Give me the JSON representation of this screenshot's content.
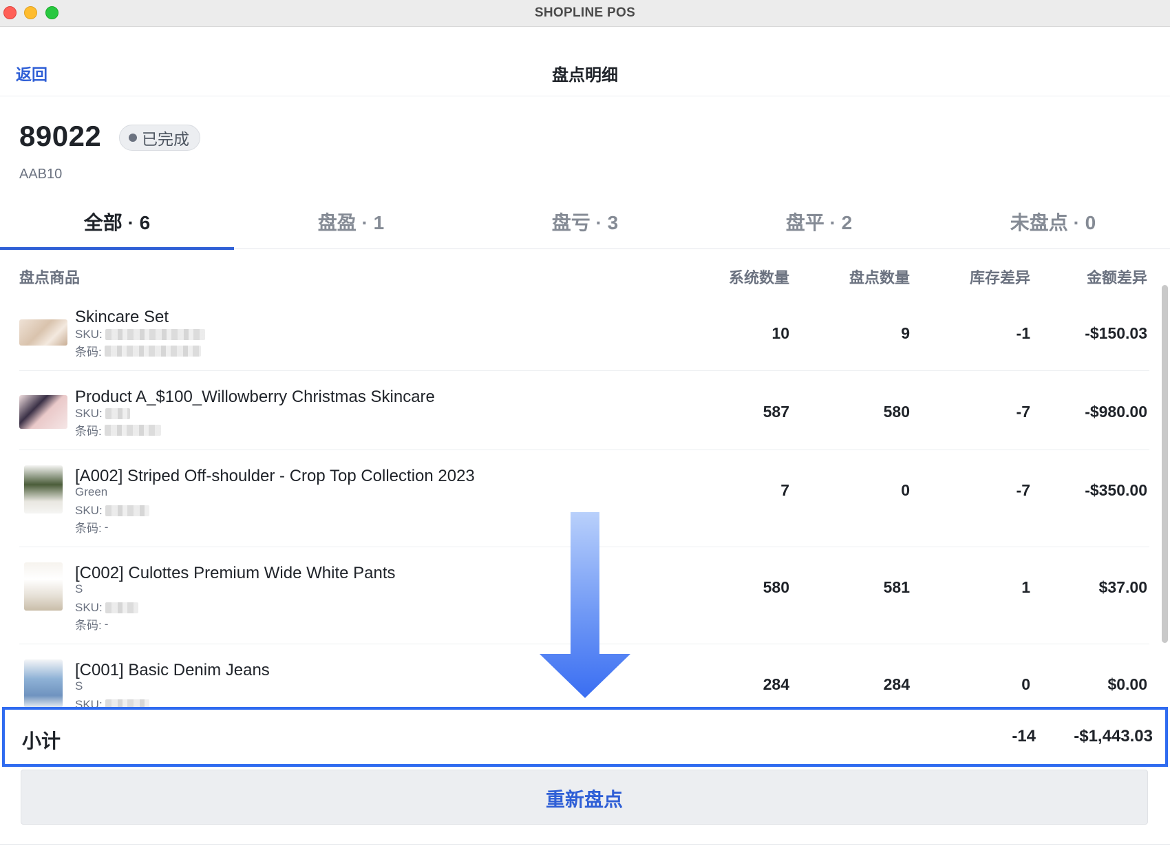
{
  "window": {
    "title": "SHOPLINE POS"
  },
  "nav": {
    "back_label": "返回",
    "title": "盘点明细"
  },
  "header": {
    "order_no": "89022",
    "status": "已完成",
    "store_code": "AAB10"
  },
  "tabs": [
    {
      "label": "全部 · 6",
      "active": true
    },
    {
      "label": "盘盈 · 1",
      "active": false
    },
    {
      "label": "盘亏 · 3",
      "active": false
    },
    {
      "label": "盘平 · 2",
      "active": false
    },
    {
      "label": "未盘点 · 0",
      "active": false
    }
  ],
  "table": {
    "columns": {
      "product": "盘点商品",
      "system_qty": "系统数量",
      "count_qty": "盘点数量",
      "stock_diff": "库存差异",
      "amount_diff": "金额差异"
    },
    "sku_label": "SKU:",
    "barcode_label": "条码:",
    "rows": [
      {
        "name": "Skincare Set",
        "variant": "",
        "barcode": "",
        "system_qty": "10",
        "count_qty": "9",
        "stock_diff": "-1",
        "amount_diff": "-$150.03"
      },
      {
        "name": "Product A_$100_Willowberry Christmas Skincare",
        "variant": "",
        "barcode": "",
        "system_qty": "587",
        "count_qty": "580",
        "stock_diff": "-7",
        "amount_diff": "-$980.00"
      },
      {
        "name": "[A002] Striped Off-shoulder - Crop Top Collection 2023",
        "variant": "Green",
        "barcode": "-",
        "system_qty": "7",
        "count_qty": "0",
        "stock_diff": "-7",
        "amount_diff": "-$350.00"
      },
      {
        "name": "[C002] Culottes Premium Wide White Pants",
        "variant": "S",
        "barcode": "-",
        "system_qty": "580",
        "count_qty": "581",
        "stock_diff": "1",
        "amount_diff": "$37.00"
      },
      {
        "name": "[C001] Basic Denim Jeans",
        "variant": "S",
        "barcode": "",
        "system_qty": "284",
        "count_qty": "284",
        "stock_diff": "0",
        "amount_diff": "$0.00"
      }
    ]
  },
  "subtotal": {
    "label": "小计",
    "stock_diff": "-14",
    "amount_diff": "-$1,443.03"
  },
  "actions": {
    "recount_label": "重新盘点"
  },
  "colors": {
    "accent": "#2f5fd6",
    "highlight_border": "#2f6bf0",
    "arrow": "#3d74f5"
  }
}
